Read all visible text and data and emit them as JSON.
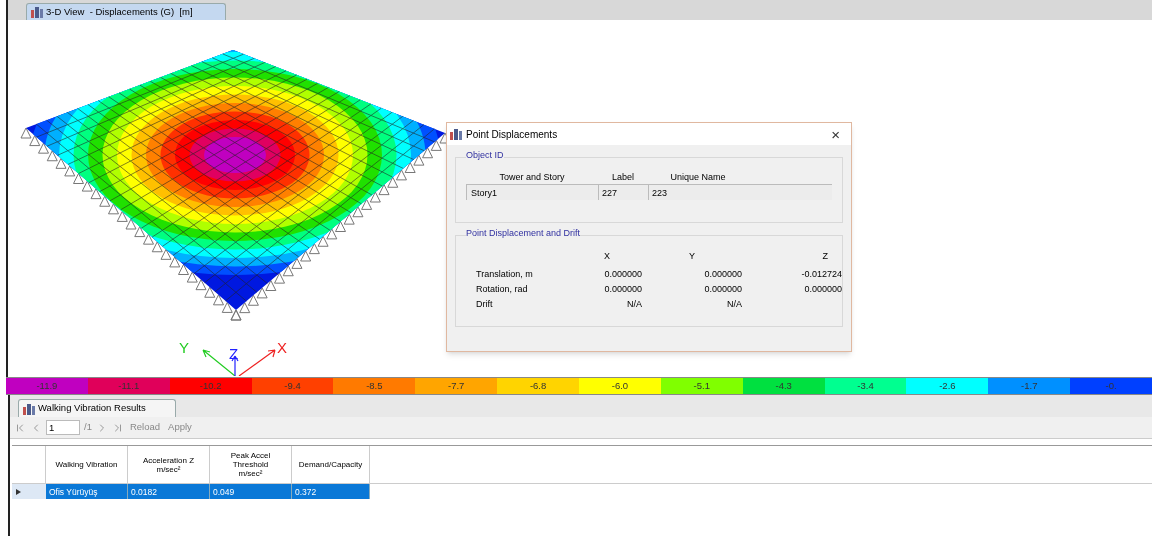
{
  "view_tab": {
    "title": "3-D View  - Displacements (G)  [m]",
    "selected": true
  },
  "axes": {
    "x": "X",
    "y": "Y",
    "z": "Z"
  },
  "dialog": {
    "title": "Point Displacements",
    "close": "×",
    "object_id": {
      "legend": "Object ID",
      "columns": [
        "Tower and Story",
        "Label",
        "Unique Name"
      ],
      "values": [
        "Story1",
        "227",
        "223"
      ]
    },
    "displacement": {
      "legend": "Point Displacement and Drift",
      "columns": [
        "X",
        "Y",
        "Z"
      ],
      "rows": [
        {
          "label": "Translation, m",
          "values": [
            "0.000000",
            "0.000000",
            "-0.012724"
          ]
        },
        {
          "label": "Rotation, rad",
          "values": [
            "0.000000",
            "0.000000",
            "0.000000"
          ]
        },
        {
          "label": "Drift",
          "values": [
            "N/A",
            "N/A"
          ]
        }
      ]
    }
  },
  "legend": [
    {
      "label": "-11.9",
      "color": "#c000c0"
    },
    {
      "label": "-11.1",
      "color": "#e0005a"
    },
    {
      "label": "-10.2",
      "color": "#ff0000"
    },
    {
      "label": "-9.4",
      "color": "#ff4000"
    },
    {
      "label": "-8.5",
      "color": "#ff7a00"
    },
    {
      "label": "-7.7",
      "color": "#ffa500"
    },
    {
      "label": "-6.8",
      "color": "#ffd400"
    },
    {
      "label": "-6.0",
      "color": "#ffff00"
    },
    {
      "label": "-5.1",
      "color": "#80ff00"
    },
    {
      "label": "-4.3",
      "color": "#00e040"
    },
    {
      "label": "-3.4",
      "color": "#00ff90"
    },
    {
      "label": "-2.6",
      "color": "#00ffff"
    },
    {
      "label": "-1.7",
      "color": "#0090ff"
    },
    {
      "label": "-0.",
      "color": "#0040ff"
    }
  ],
  "results_tab": {
    "title": "Walking Vibration Results",
    "selected": true
  },
  "toolbar": {
    "page": "1",
    "total": "/1",
    "buttons": [
      "Reload",
      "Apply"
    ]
  },
  "table": {
    "columns": [
      "Walking Vibration",
      "Acceleration Z\nm/sec²",
      "Peak Accel\nThreshold\nm/sec²",
      "Demand/Capacity"
    ],
    "rows": [
      {
        "selected": true,
        "cells": [
          "Ofis Yürüyüş",
          "0.0182",
          "0.049",
          "0.372"
        ]
      }
    ]
  }
}
